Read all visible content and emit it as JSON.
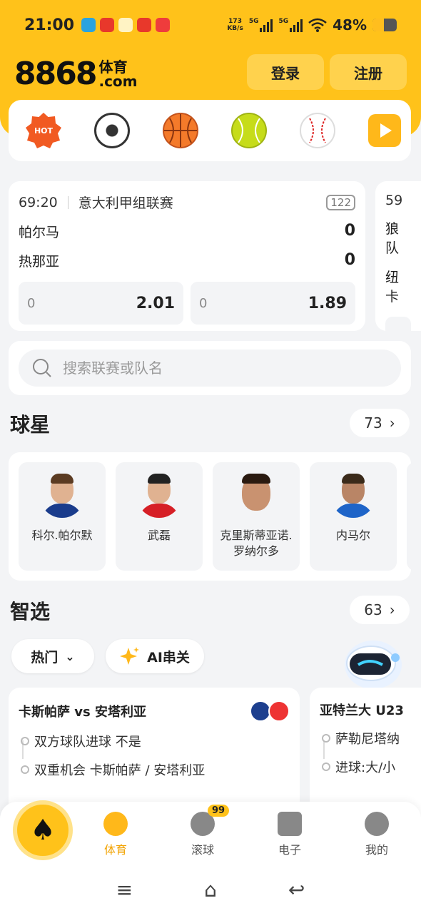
{
  "status_bar": {
    "time": "21:00",
    "speed_value": "173",
    "speed_unit": "KB/s",
    "sim1": "5G",
    "sim2": "5G",
    "battery": "48%",
    "battery_level": 0.48
  },
  "header": {
    "logo_number": "8868",
    "logo_text_top": "体育",
    "logo_text_bottom": ".com",
    "login_label": "登录",
    "register_label": "注册",
    "accent_color": "#ffc21a"
  },
  "sports_nav": {
    "hot_label": "HOT",
    "items": [
      "hot-icon",
      "soccer-ball-icon",
      "basketball-icon",
      "tennis-ball-icon",
      "baseball-icon",
      "play-icon"
    ]
  },
  "matches": [
    {
      "time": "69:20",
      "league": "意大利甲组联赛",
      "count": "122",
      "home": "帕尔马",
      "home_score": "0",
      "away": "热那亚",
      "away_score": "0",
      "odds": [
        {
          "label": "0",
          "value": "2.01"
        },
        {
          "label": "0",
          "value": "1.89"
        }
      ]
    },
    {
      "time": "59",
      "home": "狼队",
      "away": "纽卡"
    }
  ],
  "search": {
    "placeholder": "搜索联赛或队名"
  },
  "stars_section": {
    "title": "球星",
    "count": "73",
    "players": [
      {
        "name": "科尔.帕尔默",
        "shirt_color": "#1a3c8c"
      },
      {
        "name": "武磊",
        "shirt_color": "#d61f26"
      },
      {
        "name": "克里斯蒂亚诺.罗纳尔多",
        "shirt_color": "#f3f4f6"
      },
      {
        "name": "内马尔",
        "shirt_color": "#1e64c8"
      }
    ]
  },
  "picks_section": {
    "title": "智选",
    "count": "63",
    "filter_label": "热门",
    "ai_label": "AI串关",
    "cards": [
      {
        "title": "卡斯帕萨 vs 安塔利亚",
        "line1": "双方球队进球 不是",
        "line2": "双重机会 卡斯帕萨 / 安塔利亚"
      },
      {
        "title": "亚特兰大 U23",
        "line1": "萨勒尼塔纳",
        "line2": "进球:大/小"
      }
    ]
  },
  "tabbar": {
    "tabs": [
      {
        "label": "体育"
      },
      {
        "label": "滚球",
        "badge": "99"
      },
      {
        "label": "电子"
      },
      {
        "label": "我的"
      }
    ]
  }
}
